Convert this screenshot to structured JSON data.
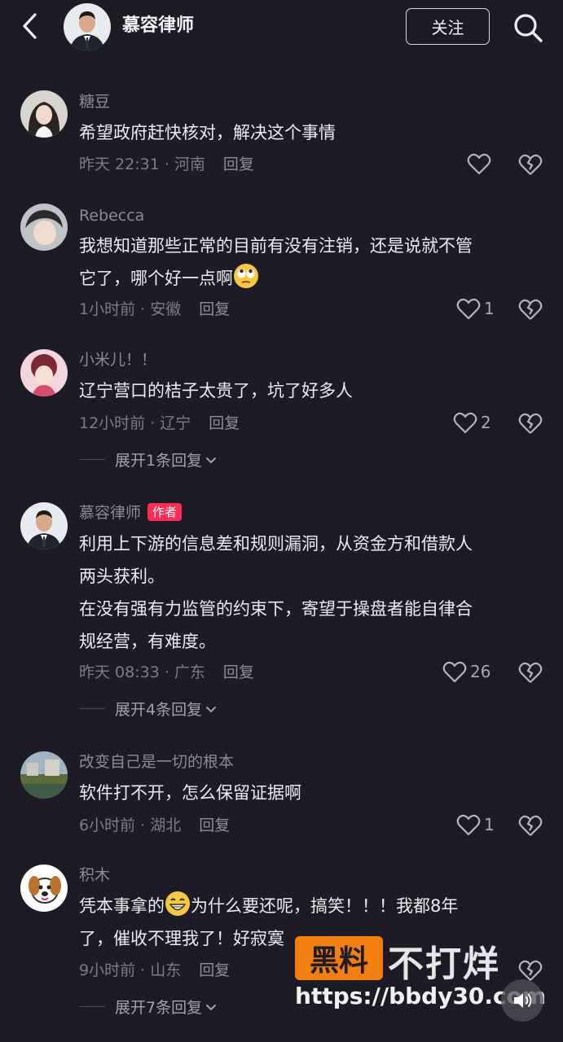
{
  "header": {
    "account_name": "慕容律师",
    "follow_label": "关注",
    "icons": {
      "back": "back-chevron-icon",
      "search": "search-icon"
    }
  },
  "comments": [
    {
      "username": "糖豆",
      "text_lines": [
        "希望政府赶快核对，解决这个事情"
      ],
      "time_location": "昨天 22:31 · 河南",
      "reply_label": "回复",
      "like_count": ""
    },
    {
      "username": "Rebecca",
      "text_lines": [
        "我想知道那些正常的目前有没有注销，还是说就不管",
        "它了，哪个好一点啊"
      ],
      "emoji": "rolling-eyes-emoji",
      "time_location": "1小时前 · 安徽",
      "reply_label": "回复",
      "like_count": "1"
    },
    {
      "username": "小米儿！！",
      "text_lines": [
        "辽宁营口的桔子太贵了，坑了好多人"
      ],
      "time_location": "12小时前 · 辽宁",
      "reply_label": "回复",
      "like_count": "2",
      "expand_label": "展开1条回复"
    },
    {
      "username": "慕容律师",
      "author_badge": "作者",
      "text_lines": [
        "利用上下游的信息差和规则漏洞，从资金方和借款人",
        "两头获利。",
        "在没有强有力监管的约束下，寄望于操盘者能自律合",
        "规经营，有难度。"
      ],
      "time_location": "昨天 08:33 · 广东",
      "reply_label": "回复",
      "like_count": "26",
      "expand_label": "展开4条回复"
    },
    {
      "username": "改变自己是一切的根本",
      "text_lines": [
        "软件打不开，怎么保留证据啊"
      ],
      "time_location": "6小时前 · 湖北",
      "reply_label": "回复",
      "like_count": "1"
    },
    {
      "username": "积木",
      "text_lines_a": "凭本事拿的",
      "emoji": "grinning-emoji",
      "text_lines_b": "为什么要还呢，搞笑！！！我都8年",
      "text_line_2": "了，催收不理我了！好寂寞",
      "time_location": "9小时前 · 山东",
      "reply_label": "回复",
      "like_count": "",
      "expand_label": "展开7条回复"
    }
  ],
  "watermark": {
    "box_text": "黑料",
    "right_text": "不打烊",
    "url": "https://bbdy30.com",
    "accent_color": "#f37f10"
  },
  "colors": {
    "background": "#1d1c26",
    "author_badge": "#fe2c55",
    "muted_text": "#7c7b86"
  }
}
